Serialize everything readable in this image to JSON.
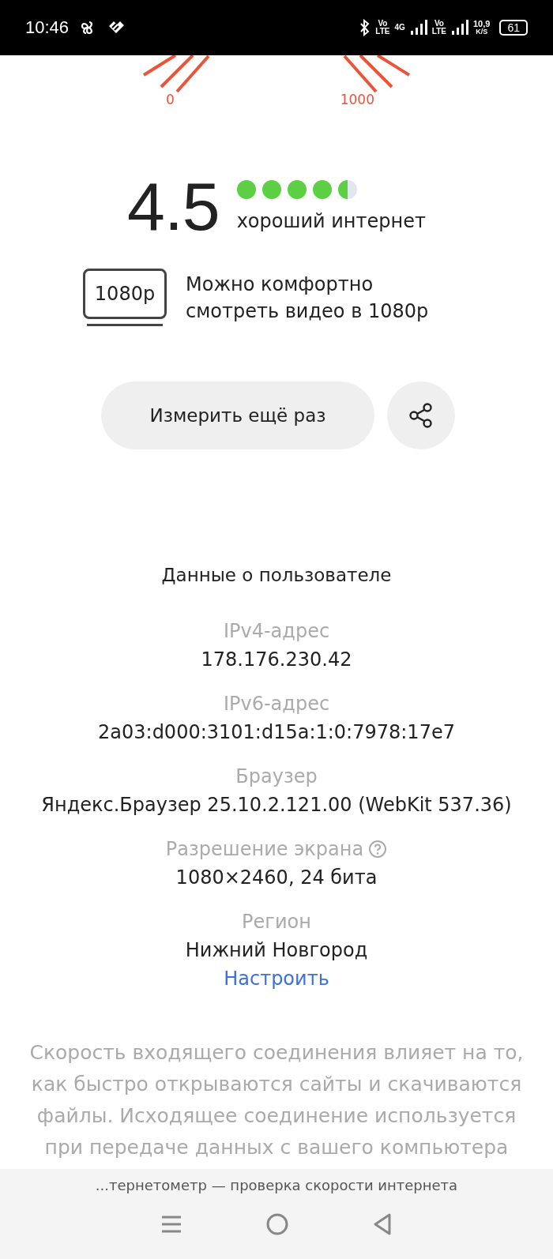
{
  "status_bar": {
    "time": "10:46",
    "net_labels": [
      "Vo\nLTE",
      "4G",
      "Vo\nLTE"
    ],
    "speed": "10,9",
    "speed_unit": "K/S",
    "battery": "61"
  },
  "gauge": {
    "min_label": "0",
    "max_label": "1000"
  },
  "rating": {
    "score": "4.5",
    "stars": 4.5,
    "verdict": "хороший интернет"
  },
  "video": {
    "badge": "1080p",
    "text": "Можно комфортно смотреть видео в 1080p"
  },
  "retry_button": "Измерить ещё раз",
  "user_data": {
    "title": "Данные о пользователе",
    "fields": [
      {
        "label": "IPv4-адрес",
        "value": "178.176.230.42",
        "help": false
      },
      {
        "label": "IPv6-адрес",
        "value": "2a03:d000:3101:d15a:1:0:7978:17e7",
        "help": false
      },
      {
        "label": "Браузер",
        "value": "Яндекс.Браузер 25.10.2.121.00 (WebKit 537.36)",
        "help": false
      },
      {
        "label": "Разрешение экрана",
        "value": "1080×2460, 24 бита",
        "help": true
      },
      {
        "label": "Регион",
        "value": "Нижний Новгород",
        "help": false
      }
    ],
    "link": "Настроить"
  },
  "description": "Скорость входящего соединения влияет на то, как быстро открываются сайты и скачиваются файлы. Исходящее соединение используется при передаче данных с вашего компьютера",
  "page_title_bar": "...тернетометр — проверка скорости интернета"
}
